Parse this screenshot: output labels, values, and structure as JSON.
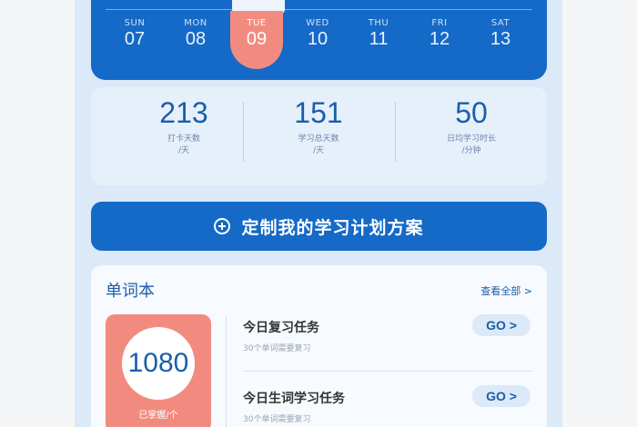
{
  "week": {
    "days": [
      {
        "name": "SUN",
        "date": "07"
      },
      {
        "name": "MON",
        "date": "08"
      },
      {
        "name": "TUE",
        "date": "09",
        "selected": true
      },
      {
        "name": "WED",
        "date": "10"
      },
      {
        "name": "THU",
        "date": "11"
      },
      {
        "name": "FRI",
        "date": "12"
      },
      {
        "name": "SAT",
        "date": "13"
      }
    ]
  },
  "stats": [
    {
      "value": "213",
      "label": "打卡天数",
      "unit": "/天"
    },
    {
      "value": "151",
      "label": "学习总天数",
      "unit": "/天"
    },
    {
      "value": "50",
      "label": "日均学习时长",
      "unit": "/分钟"
    }
  ],
  "plan_button": {
    "label": "定制我的学习计划方案"
  },
  "vocab": {
    "title": "单词本",
    "view_all": "查看全部 >",
    "count": "1080",
    "count_label": "已掌握/个",
    "tasks": [
      {
        "title": "今日复习任务",
        "subtitle": "30个单词需要复习",
        "action": "GO >"
      },
      {
        "title": "今日生词学习任务",
        "subtitle": "30个单词需要复习",
        "action": "GO >"
      }
    ]
  },
  "colors": {
    "primary": "#1569c7",
    "accent": "#f28b7f",
    "background": "#dbe9f8"
  }
}
